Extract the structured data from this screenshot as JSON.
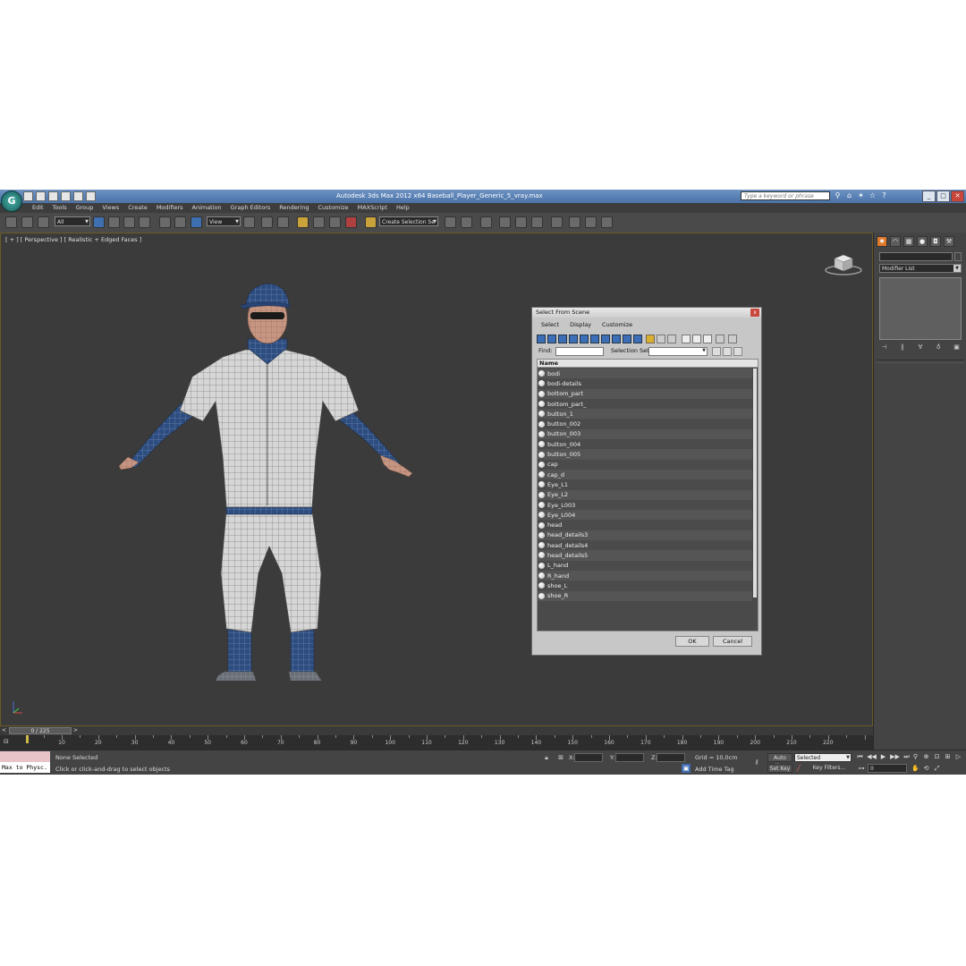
{
  "app": {
    "title": "Autodesk 3ds Max  2012 x64      Baseball_Player_Generic_5_vray.max",
    "logo_label": "G",
    "search_placeholder": "Type a keyword or phrase",
    "window_controls": [
      "_",
      "□",
      "✕"
    ]
  },
  "menu": [
    "Edit",
    "Tools",
    "Group",
    "Views",
    "Create",
    "Modifiers",
    "Animation",
    "Graph Editors",
    "Rendering",
    "Customize",
    "MAXScript",
    "Help"
  ],
  "toolbar": {
    "filter_value": "All",
    "ref_coord_value": "View",
    "selection_set_value": "Create Selection Se"
  },
  "viewport": {
    "label": "[ + ] [ Perspective ] [ Realistic + Edged Faces ]"
  },
  "command_panel": {
    "modifier_list_label": "Modifier List"
  },
  "time_slider": {
    "position_label": "0 / 225",
    "prev": "<",
    "next": ">"
  },
  "trackbar": {
    "labels": [
      "10",
      "20",
      "30",
      "40",
      "50",
      "60",
      "70",
      "80",
      "90",
      "100",
      "110",
      "120",
      "130",
      "140",
      "150",
      "160",
      "170",
      "180",
      "190",
      "200",
      "210",
      "220"
    ]
  },
  "status": {
    "maxscript_text": "Max to Physc.",
    "selection_status": "None Selected",
    "prompt": "Click or click-and-drag to select objects",
    "x_label": "X:",
    "y_label": "Y:",
    "z_label": "Z:",
    "grid": "Grid = 10,0cm",
    "add_time_tag": "Add Time Tag",
    "auto_key": "Auto Key",
    "set_key": "Set Key",
    "selected_value": "Selected",
    "key_filters": "Key Filters...",
    "frame_value": "0"
  },
  "dialog": {
    "title": "Select From Scene",
    "close": "x",
    "menu": [
      "Select",
      "Display",
      "Customize"
    ],
    "find_label": "Find:",
    "selection_set_label": "Selection Set:",
    "column_header": "Name",
    "items": [
      "bodi",
      "bodi-details",
      "bottom_part",
      "bottom_part_",
      "button_1",
      "button_002",
      "button_003",
      "button_004",
      "button_005",
      "cap",
      "cap_d",
      "Eye_L1",
      "Eye_L2",
      "Eye_L003",
      "Eye_L004",
      "head",
      "head_details3",
      "head_details4",
      "head_details5",
      "L_hand",
      "R_hand",
      "shoe_L",
      "shoe_R"
    ],
    "ok": "OK",
    "cancel": "Cancel"
  },
  "colors": {
    "viewport_bg": "#3b3b3b",
    "uniform_white": "#d9d9d9",
    "uniform_navy": "#2c4a7a",
    "skin": "#c99a86",
    "titlebar": "#5a80b5"
  }
}
